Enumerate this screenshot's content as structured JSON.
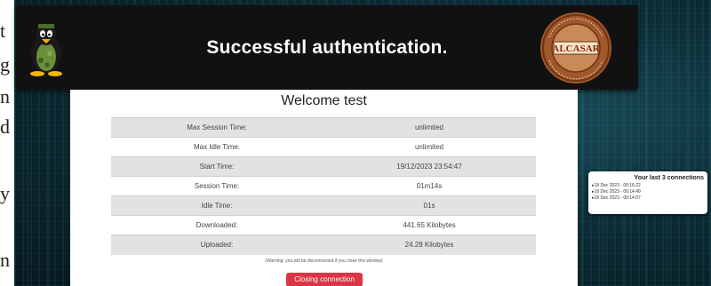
{
  "background_page": {
    "letters": [
      "t",
      "g",
      "n",
      "d",
      "y",
      "n"
    ]
  },
  "header": {
    "title": "Successful authentication.",
    "seal_text": "ALCASAR",
    "background": "#111111"
  },
  "main": {
    "welcome": "Welcome test",
    "rows": [
      {
        "label": "Max Session Time:",
        "value": "unlimited"
      },
      {
        "label": "Max Idle Time:",
        "value": "unlimited"
      },
      {
        "label": "Start Time:",
        "value": "19/12/2023 23:54:47"
      },
      {
        "label": "Session Time:",
        "value": "01m14s"
      },
      {
        "label": "Idle Time:",
        "value": "01s"
      },
      {
        "label": "Downloaded:",
        "value": "441.65 Kilobytes"
      },
      {
        "label": "Uploaded:",
        "value": "24.28 Kilobytes"
      }
    ],
    "warning": "(Warning: you will be disconnected if you close this window)",
    "close_button": "Closing connection",
    "button_color": "#dc3545"
  },
  "last_connections": {
    "title": "Your last 3 connections",
    "items": [
      "18 Dec 2023 - 00:16:22",
      "18 Dec 2023 - 00:14:49",
      "18 Dec 2023 - 00:14:07"
    ]
  }
}
